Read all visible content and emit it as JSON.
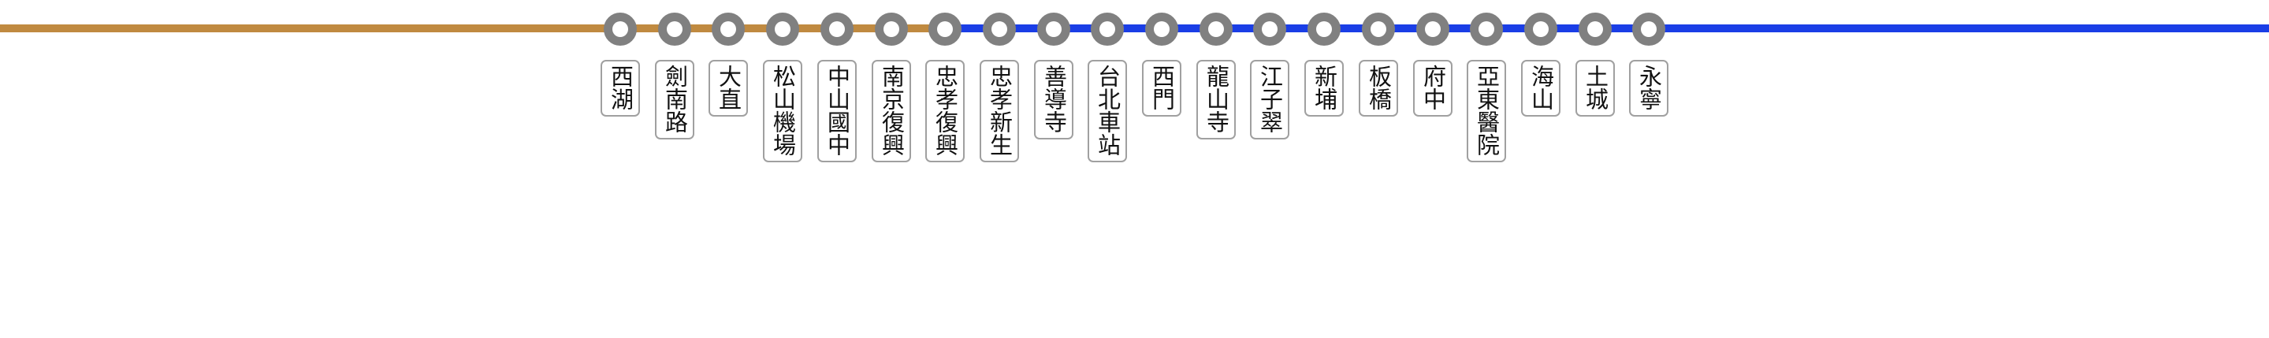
{
  "line": {
    "segments": [
      {
        "color": "#c08a40"
      },
      {
        "color": "#1a3ee6"
      }
    ]
  },
  "stations": [
    {
      "name": "西湖"
    },
    {
      "name": "劍南路"
    },
    {
      "name": "大直"
    },
    {
      "name": "松山機場"
    },
    {
      "name": "中山國中"
    },
    {
      "name": "南京復興"
    },
    {
      "name": "忠孝復興"
    },
    {
      "name": "忠孝新生"
    },
    {
      "name": "善導寺"
    },
    {
      "name": "台北車站"
    },
    {
      "name": "西門"
    },
    {
      "name": "龍山寺"
    },
    {
      "name": "江子翠"
    },
    {
      "name": "新埔"
    },
    {
      "name": "板橋"
    },
    {
      "name": "府中"
    },
    {
      "name": "亞東醫院"
    },
    {
      "name": "海山"
    },
    {
      "name": "土城"
    },
    {
      "name": "永寧"
    }
  ],
  "colors": {
    "station_marker": "#808080",
    "label_border": "#a0a0a0"
  }
}
